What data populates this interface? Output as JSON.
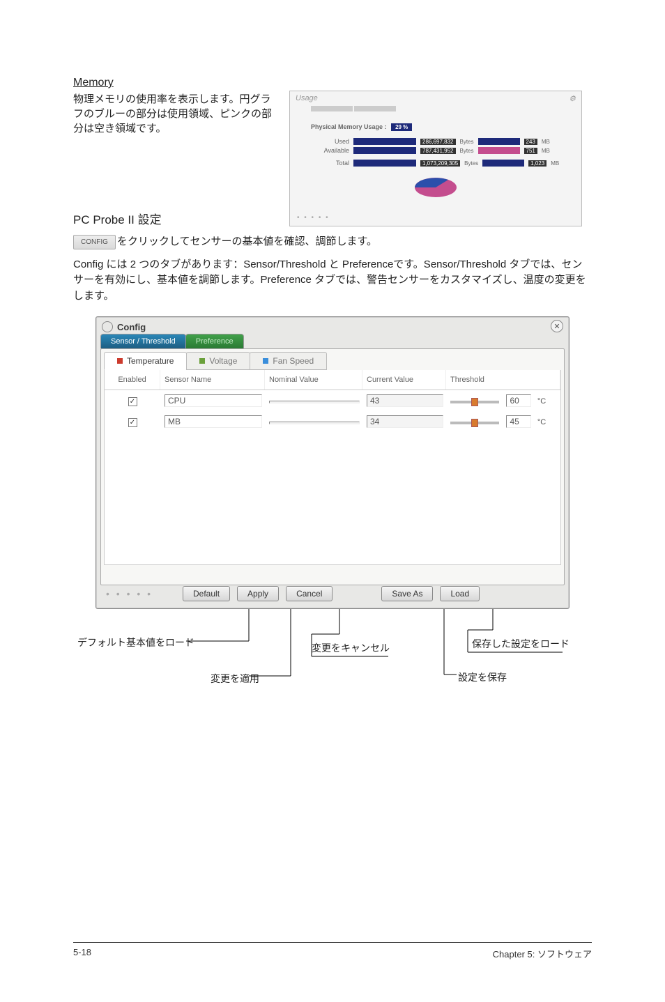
{
  "memory": {
    "heading": "Memory",
    "description": "物理メモリの使用率を表示します。円グラフのブルーの部分は使用領域、ピンクの部分は空き領域です。",
    "panel": {
      "title": "Usage",
      "bar_label": "Physical Memory Usage :",
      "percent": "29 %",
      "rows": [
        {
          "label": "Used",
          "val": "286,697,832",
          "unit": "Bytes",
          "tag": "243",
          "suf": "MB",
          "color": "blue"
        },
        {
          "label": "Available",
          "val": "787,431,952",
          "unit": "Bytes",
          "tag": "751",
          "suf": "MB",
          "color": "pink"
        },
        {
          "label": "Total",
          "val": "1,073,209,305",
          "unit": "Bytes",
          "tag": "1,023",
          "suf": "MB",
          "color": "blue"
        }
      ]
    }
  },
  "probe": {
    "heading": "PC Probe II 設定",
    "config_btn": "CONFIG",
    "line1_suffix": "をクリックしてセンサーの基本値を確認、調節します。",
    "line2": "Config には 2 つのタブがあります：Sensor/Threshold と Preferenceです。Sensor/Threshold タブでは、センサーを有効にし、基本値を調節します。Preference タブでは、警告センサーをカスタマイズし、温度の変更をします。"
  },
  "config_window": {
    "title": "Config",
    "outer_tabs": {
      "active": "Sensor / Threshold",
      "other": "Preference"
    },
    "inner_tabs": [
      "Temperature",
      "Voltage",
      "Fan Speed"
    ],
    "columns": [
      "Enabled",
      "Sensor Name",
      "Nominal Value",
      "Current Value",
      "Threshold"
    ],
    "rows": [
      {
        "enabled": true,
        "name": "CPU",
        "nominal": "",
        "current": "43",
        "threshold": "60",
        "unit": "°C"
      },
      {
        "enabled": true,
        "name": "MB",
        "nominal": "",
        "current": "34",
        "threshold": "45",
        "unit": "°C"
      }
    ],
    "buttons": {
      "default": "Default",
      "apply": "Apply",
      "cancel": "Cancel",
      "save": "Save As",
      "load": "Load"
    }
  },
  "callouts": {
    "default_load": "デフォルト基本値をロード",
    "cancel": "変更をキャンセル",
    "load_saved": "保存した設定をロード",
    "apply": "変更を適用",
    "save": "設定を保存"
  },
  "footer": {
    "left": "5-18",
    "right": "Chapter 5: ソフトウェア"
  }
}
